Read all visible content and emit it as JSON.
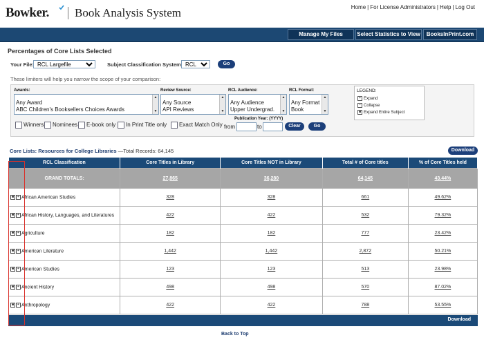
{
  "header": {
    "logo": "Bowker.",
    "app_title": "Book Analysis System",
    "links": [
      "Home",
      "For License Administrators",
      "Help",
      "Log Out"
    ]
  },
  "nav": {
    "buttons": [
      "Manage My Files",
      "Select Statistics to View",
      "BooksInPrint.com"
    ]
  },
  "section_title": "Percentages of Core Lists Selected",
  "controls": {
    "file_label": "Your File:",
    "file_value": "RCL Largefile",
    "subject_label": "Subject Classification System:",
    "subject_value": "RCL",
    "go": "Go",
    "limiters_text": "These limiters will help you narrow the scope of your comparison:"
  },
  "filters": {
    "awards_label": "Awards:",
    "awards_options": [
      "Any Award",
      "ABC Children's Booksellers Choices Awards"
    ],
    "review_label": "Review Source:",
    "review_options": [
      "Any Source",
      "API Reviews"
    ],
    "audience_label": "RCL Audience:",
    "audience_options": [
      "Any Audience",
      "Upper Undergrad."
    ],
    "format_label": "RCL Format:",
    "format_options": [
      "Any Format",
      "Book"
    ],
    "checkboxes": [
      "Winners",
      "Nominees",
      "E-book only",
      "In Print Title only",
      "Exact Match Only"
    ],
    "pubyear_label": "Publication Year: (YYYY)",
    "from_label": "from",
    "to_label": "to",
    "clear": "Clear",
    "go": "Go"
  },
  "legend": {
    "title": "LEGEND:",
    "items": [
      "Expand",
      "Collapse",
      "Expand Entire Subject"
    ]
  },
  "core": {
    "link": "Core Lists: Resources for College Libraries",
    "total": "—Total Records: 64,145",
    "download": "Download"
  },
  "table": {
    "headers": [
      "RCL Classification",
      "Core Titles in Library",
      "Core Titles NOT in Library",
      "Total # of Core titles",
      "% of Core Titles held"
    ],
    "grand": [
      "GRAND TOTALS:",
      "27,865",
      "36,280",
      "64,145",
      "43.44%"
    ],
    "rows": [
      [
        "African American Studies",
        "328",
        "328",
        "661",
        "49.62%"
      ],
      [
        "African History, Languages, and Literatures",
        "422",
        "422",
        "532",
        "79.32%"
      ],
      [
        "Agriculture",
        "182",
        "182",
        "777",
        "23.42%"
      ],
      [
        "American Literature",
        "1,442",
        "1,442",
        "2,872",
        "50.21%"
      ],
      [
        "American Studies",
        "123",
        "123",
        "513",
        "23.98%"
      ],
      [
        "Ancient History",
        "498",
        "498",
        "570",
        "87.02%"
      ],
      [
        "Anthropology",
        "422",
        "422",
        "788",
        "53.55%"
      ]
    ],
    "footer_download": "Download"
  },
  "back_to_top": "Back to Top",
  "colors": {
    "nav_blue": "#1c4873",
    "table_header": "#1b4a78",
    "grand_row": "#a6a6a6",
    "highlight": "#d9302a"
  }
}
